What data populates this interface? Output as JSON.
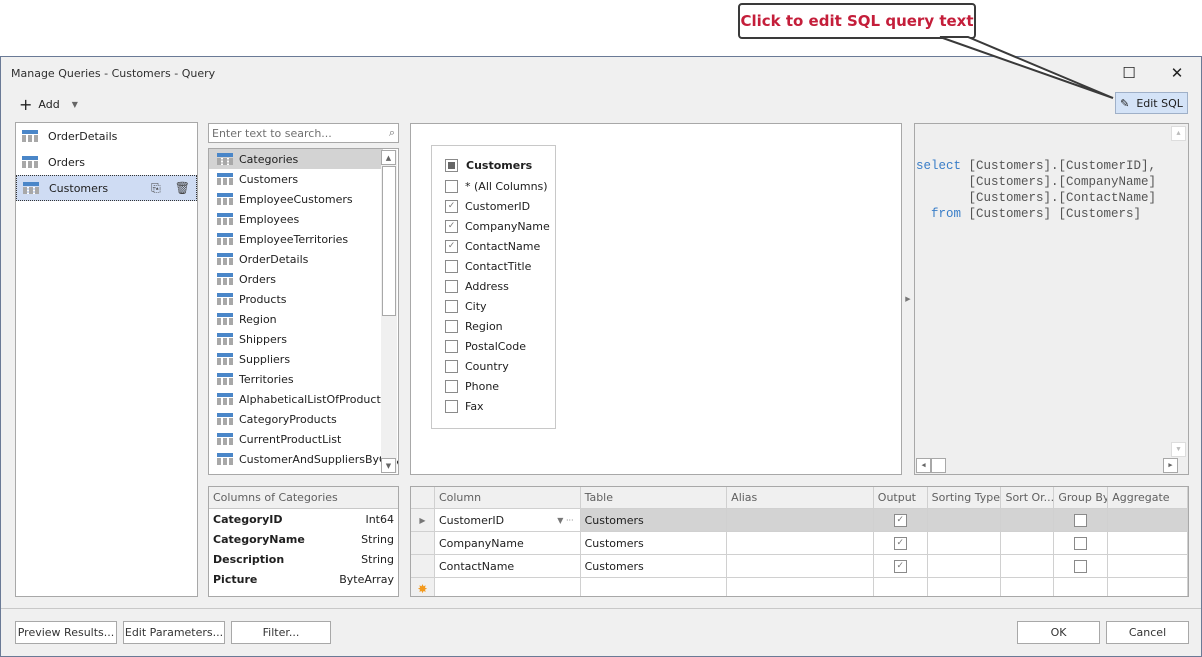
{
  "callout": {
    "text": "Click to edit SQL query text"
  },
  "window": {
    "title": "Manage Queries - Customers - Query",
    "maximize_icon": "maximize-icon",
    "close_icon": "close-icon"
  },
  "toolbar": {
    "add_label": "Add",
    "edit_sql_label": "Edit SQL"
  },
  "queries": [
    {
      "label": "OrderDetails",
      "selected": false
    },
    {
      "label": "Orders",
      "selected": false
    },
    {
      "label": "Customers",
      "selected": true
    }
  ],
  "search": {
    "placeholder": "Enter text to search..."
  },
  "tables": [
    "Categories",
    "Customers",
    "EmployeeCustomers",
    "Employees",
    "EmployeeTerritories",
    "OrderDetails",
    "Orders",
    "Products",
    "Region",
    "Shippers",
    "Suppliers",
    "Territories",
    "AlphabeticalListOfProducts",
    "CategoryProducts",
    "CurrentProductList",
    "CustomerAndSuppliersByCity"
  ],
  "selected_table": "Categories",
  "entity": {
    "name": "Customers",
    "columns": [
      {
        "name": "* (All Columns)",
        "checked": false
      },
      {
        "name": "CustomerID",
        "checked": true
      },
      {
        "name": "CompanyName",
        "checked": true
      },
      {
        "name": "ContactName",
        "checked": true
      },
      {
        "name": "ContactTitle",
        "checked": false
      },
      {
        "name": "Address",
        "checked": false
      },
      {
        "name": "City",
        "checked": false
      },
      {
        "name": "Region",
        "checked": false
      },
      {
        "name": "PostalCode",
        "checked": false
      },
      {
        "name": "Country",
        "checked": false
      },
      {
        "name": "Phone",
        "checked": false
      },
      {
        "name": "Fax",
        "checked": false
      }
    ]
  },
  "sql": {
    "lines": [
      {
        "kw": "select",
        "text": " [Customers].[CustomerID],"
      },
      {
        "kw": "      ",
        "text": " [Customers].[CompanyName]"
      },
      {
        "kw": "      ",
        "text": " [Customers].[ContactName]"
      },
      {
        "kw": "  from",
        "text": " [Customers] [Customers]"
      }
    ]
  },
  "columns_of": {
    "header": "Columns of Categories",
    "rows": [
      {
        "name": "CategoryID",
        "type": "Int64"
      },
      {
        "name": "CategoryName",
        "type": "String"
      },
      {
        "name": "Description",
        "type": "String"
      },
      {
        "name": "Picture",
        "type": "ByteArray"
      }
    ]
  },
  "grid": {
    "headers": [
      "Column",
      "Table",
      "Alias",
      "Output",
      "Sorting Type",
      "Sort Or...",
      "Group By",
      "Aggregate"
    ],
    "rows": [
      {
        "column": "CustomerID",
        "table": "Customers",
        "alias": "",
        "output": true,
        "sorting_type": "",
        "sort_order": "",
        "group_by": false,
        "aggregate": ""
      },
      {
        "column": "CompanyName",
        "table": "Customers",
        "alias": "",
        "output": true,
        "sorting_type": "",
        "sort_order": "",
        "group_by": false,
        "aggregate": ""
      },
      {
        "column": "ContactName",
        "table": "Customers",
        "alias": "",
        "output": true,
        "sorting_type": "",
        "sort_order": "",
        "group_by": false,
        "aggregate": ""
      }
    ]
  },
  "footer": {
    "preview_label": "Preview Results...",
    "params_label": "Edit Parameters...",
    "filter_label": "Filter...",
    "ok_label": "OK",
    "cancel_label": "Cancel"
  }
}
